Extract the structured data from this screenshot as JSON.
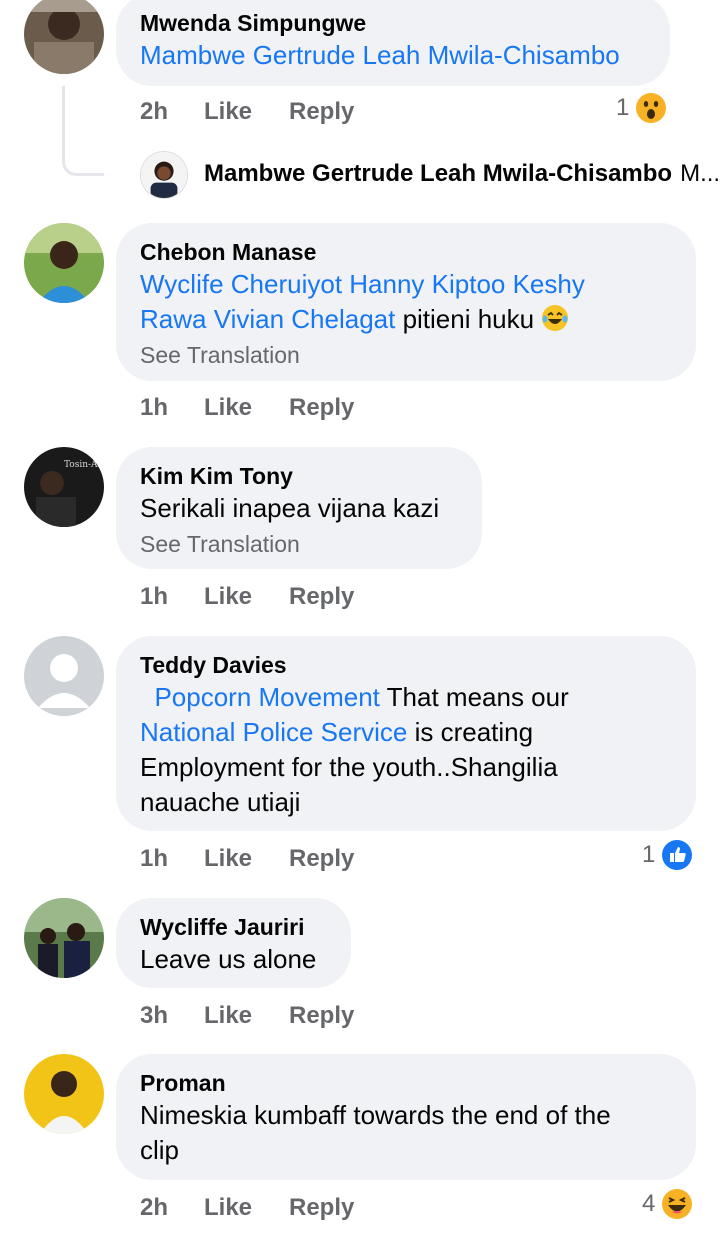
{
  "comments": [
    {
      "author": "Mwenda Simpungwe",
      "mentions": [
        "Mambwe Gertrude Leah Mwila-Chisambo"
      ],
      "time": "2h",
      "like": "Like",
      "reply": "Reply",
      "reaction_count": "1",
      "reaction_icon": "wow-icon"
    },
    {
      "author": "Chebon Manase",
      "mention1": "Wyclife Cheruiyot Hanny Kiptoo Keshy",
      "mention2": "Rawa Vivian Chelagat",
      "text": " pitieni huku ",
      "see_translation": "See Translation",
      "time": "1h",
      "like": "Like",
      "reply": "Reply"
    },
    {
      "author": "Kim Kim Tony",
      "text": "Serikali inapea vijana kazi",
      "see_translation": "See Translation",
      "avatar_text": "Tosin-Abasi",
      "time": "1h",
      "like": "Like",
      "reply": "Reply"
    },
    {
      "author": "Teddy Davies",
      "mention1": "Popcorn Movement",
      "text1": " That means our",
      "mention2": "National Police Service",
      "text2": " is creating",
      "text3": "Employment for the youth..Shangilia",
      "text4": "nauache utiaji",
      "time": "1h",
      "like": "Like",
      "reply": "Reply",
      "reaction_count": "1",
      "reaction_icon": "like-icon"
    },
    {
      "author": "Wycliffe Jauriri",
      "text": "Leave us alone",
      "time": "3h",
      "like": "Like",
      "reply": "Reply"
    },
    {
      "author": "Proman",
      "text1": "Nimeskia kumbaff towards the end of the",
      "text2": "clip",
      "time": "2h",
      "like": "Like",
      "reply": "Reply",
      "reaction_count": "4",
      "reaction_icon": "haha-icon"
    }
  ],
  "reply_preview": {
    "name": "Mambwe Gertrude Leah Mwila-Chisambo",
    "snippet": "M..."
  },
  "colors": {
    "link": "#1877f2",
    "bubble": "#f0f2f5",
    "meta": "#65676b"
  }
}
